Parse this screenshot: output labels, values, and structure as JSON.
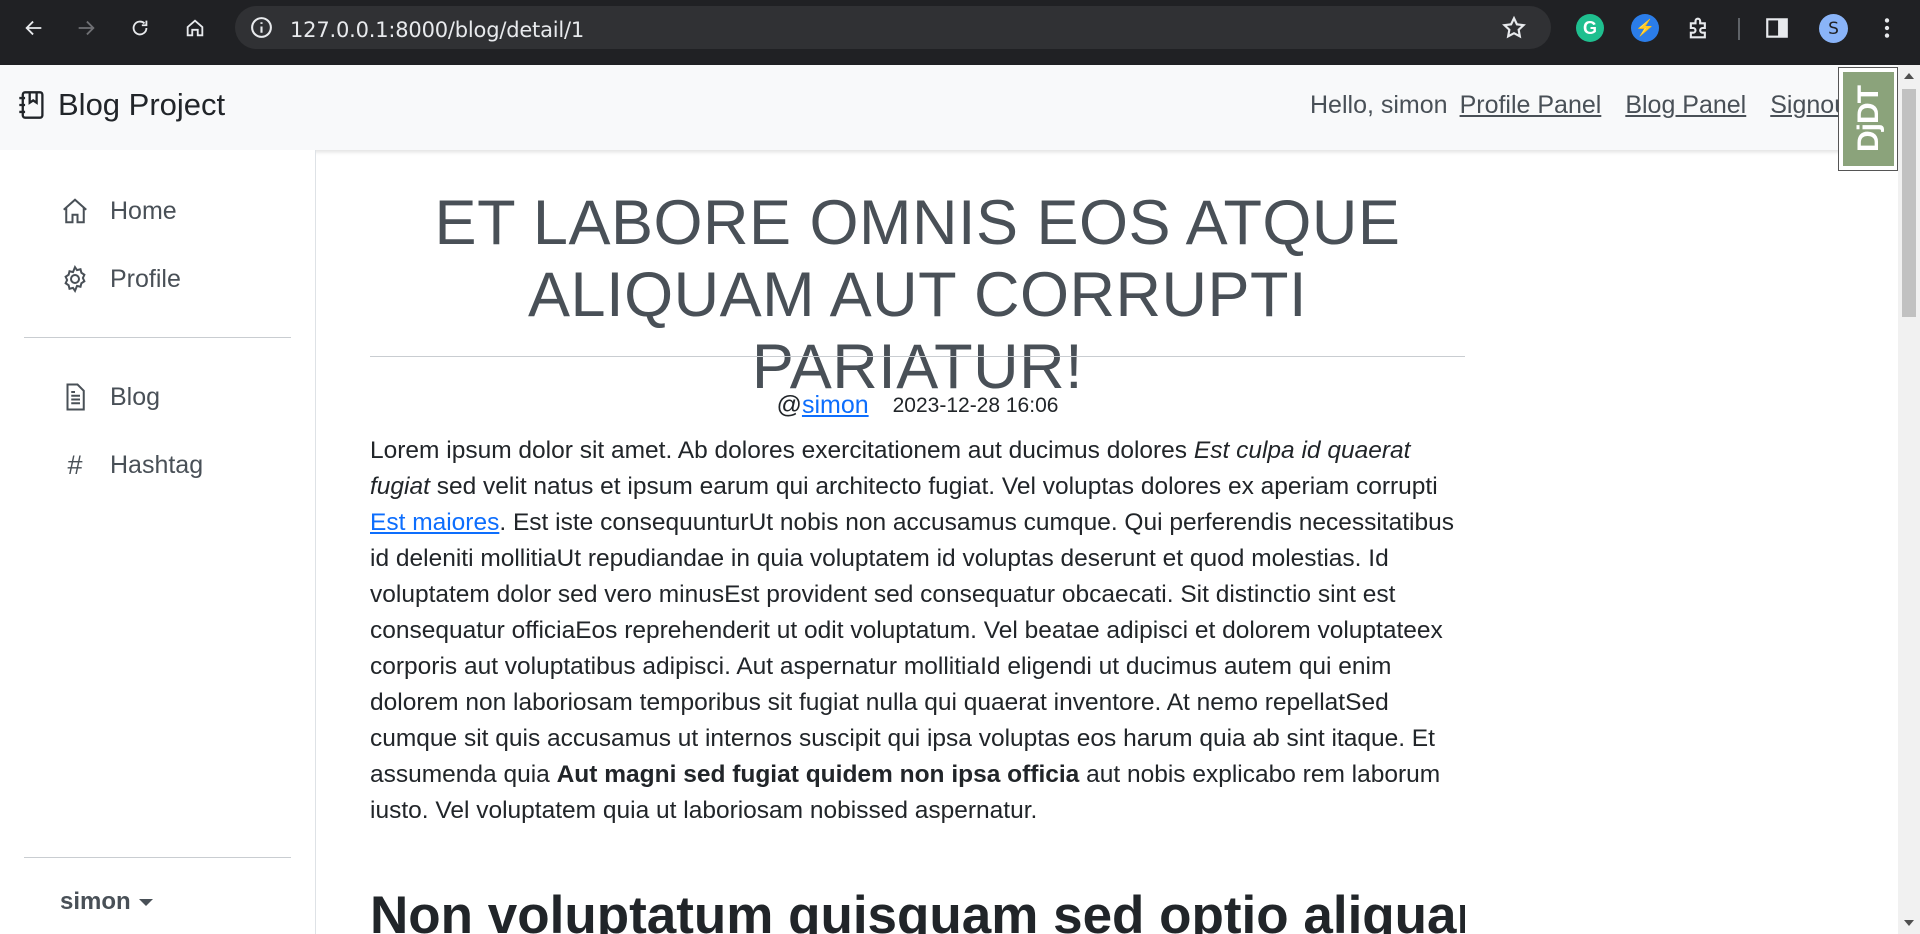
{
  "browser": {
    "url": "127.0.0.1:8000/blog/detail/1",
    "avatar_letter": "S",
    "ext_colors": [
      "#1fbf8f",
      "#2b7de9"
    ]
  },
  "header": {
    "brand": "Blog Project",
    "greeting": "Hello, simon",
    "links": [
      "Profile Panel",
      "Blog Panel",
      "Signout"
    ]
  },
  "djdt": {
    "label": "DjDT"
  },
  "sidebar": {
    "items": [
      {
        "label": "Home",
        "icon": "house-icon"
      },
      {
        "label": "Profile",
        "icon": "gear-icon"
      },
      {
        "label": "Blog",
        "icon": "document-icon"
      },
      {
        "label": "Hashtag",
        "icon": "hash-icon",
        "glyph": "#"
      }
    ],
    "user": "simon"
  },
  "post": {
    "title_line1": "ET LABORE OMNIS EOS ATQUE",
    "title_line2": "ALIQUAM AUT CORRUPTI PARIATUR!",
    "at": "@",
    "author": "simon",
    "date": "2023-12-28 16:06",
    "body": {
      "p1": "Lorem ipsum dolor sit amet. Ab dolores exercitationem aut ducimus dolores ",
      "italic": "Est culpa id quaerat fugiat",
      "p2": " sed velit natus et ipsum earum qui architecto fugiat. Vel voluptas dolores ex aperiam corrupti ",
      "link": "Est maiores",
      "p3": ". Est iste consequunturUt nobis non accusamus cumque. Qui perferendis necessitatibus id deleniti mollitiaUt repudiandae in quia voluptatem id voluptas deserunt et quod molestias. Id voluptatem dolor sed vero minusEst provident sed consequatur obcaecati. Sit distinctio sint est consequatur officiaEos reprehenderit ut odit voluptatum. Vel beatae adipisci et dolorem voluptateex corporis aut voluptatibus adipisci. Aut aspernatur mollitiaId eligendi ut ducimus autem qui enim dolorem non laboriosam temporibus sit fugiat nulla qui quaerat inventore. At nemo repellatSed cumque sit quis accusamus ut internos suscipit qui ipsa voluptas eos harum quia ab sint itaque. Et assumenda quia ",
      "bold": "Aut magni sed fugiat quidem non ipsa officia",
      "p4": " aut nobis explicabo rem laborum iusto. Vel voluptatem quia ut laboriosam nobissed aspernatur."
    },
    "subheading": "Non voluptatum quisquam sed optio aliquam"
  }
}
